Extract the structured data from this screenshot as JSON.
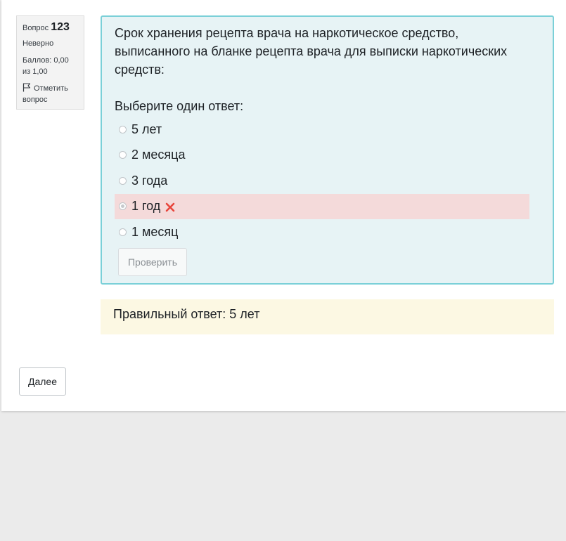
{
  "question_info": {
    "label": "Вопрос",
    "number": "123",
    "state": "Неверно",
    "grade": "Баллов: 0,00 из 1,00",
    "flag_label": "Отметить вопрос",
    "flag_icon": "flag-icon"
  },
  "question": {
    "text": "Срок хранения рецепта врача на наркотическое средство, выписанного на бланке рецепта врача для выписки наркотических средств:",
    "prompt": "Выберите один ответ:",
    "answers": [
      {
        "label": "5 лет",
        "selected": false,
        "incorrect": false
      },
      {
        "label": "2 месяца",
        "selected": false,
        "incorrect": false
      },
      {
        "label": "3 года",
        "selected": false,
        "incorrect": false
      },
      {
        "label": "1 год",
        "selected": true,
        "incorrect": true,
        "icon": "cross-icon"
      },
      {
        "label": "1 месяц",
        "selected": false,
        "incorrect": false
      }
    ],
    "check_button": "Проверить"
  },
  "feedback": {
    "right_answer": "Правильный ответ: 5 лет"
  },
  "navigation": {
    "next_button": "Далее"
  },
  "colors": {
    "page_background": "#ebebeb",
    "formulation_background": "#e7f3f5",
    "formulation_border": "#7bd0d8",
    "incorrect_background": "#f4dada",
    "incorrect_icon": "#e8453c",
    "feedback_background": "#fcf8e3"
  }
}
